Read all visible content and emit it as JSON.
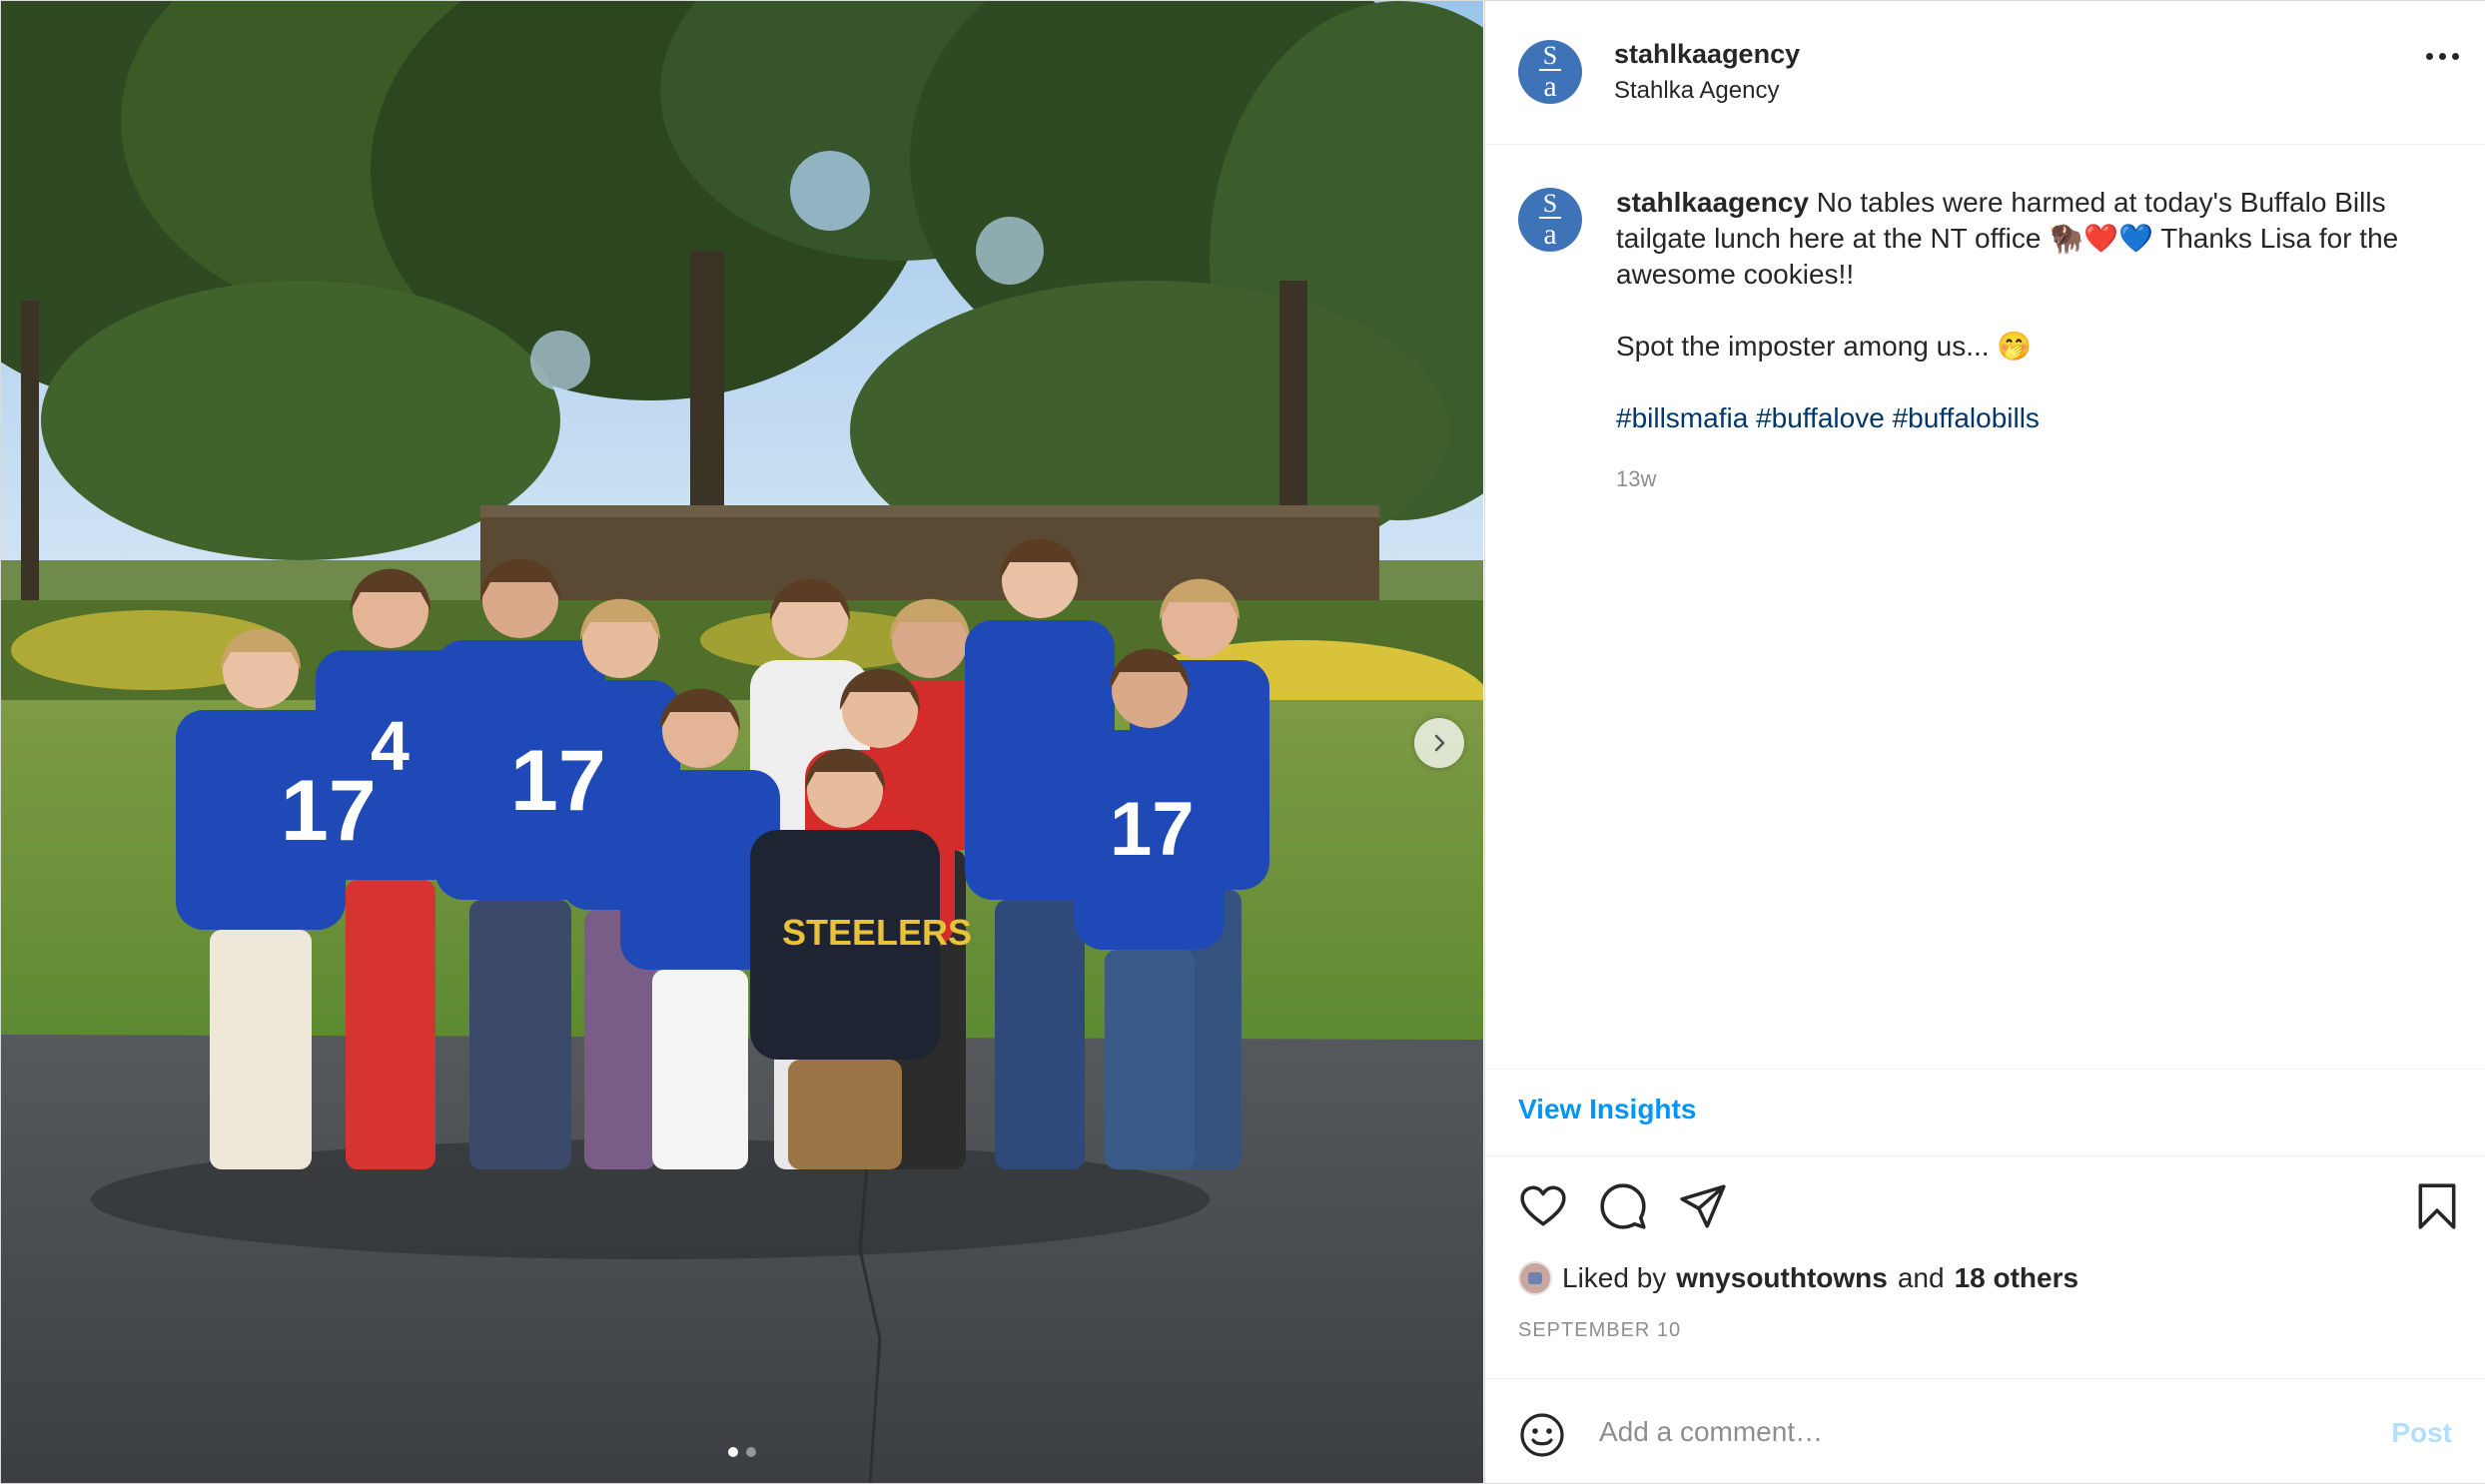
{
  "colors": {
    "accent": "#0095f6",
    "avatar_bg": "#3f73b8",
    "hashtag": "#00376b",
    "muted": "#8e8e8e",
    "post_disabled": "#b2dffc",
    "bills_blue": "#1f49b6",
    "bills_red": "#d42b2b"
  },
  "photo": {
    "description_icon": "group-photo",
    "jersey_numbers": [
      "17",
      "4",
      "17",
      "17"
    ],
    "shirt_text": "STEELERS",
    "carousel": {
      "total": 2,
      "current": 1
    },
    "next_icon": "chevron-right-icon"
  },
  "header": {
    "avatar_letters": {
      "top": "S",
      "bottom": "a"
    },
    "username": "stahlkaagency",
    "subname": "Stahlka Agency",
    "more_icon": "more-horizontal-icon"
  },
  "caption": {
    "username": "stahlkaagency",
    "text": " No tables were harmed at today's Buffalo Bills tailgate lunch here at the NT office 🦬❤️💙 Thanks Lisa for the awesome cookies!!",
    "line2": "Spot the imposter among us... 🤭",
    "hashtags": [
      "#billsmafia",
      "#buffalove",
      "#buffalobills"
    ],
    "time": "13w"
  },
  "insights": {
    "label": "View Insights"
  },
  "actions": {
    "like_icon": "heart-icon",
    "comment_icon": "comment-icon",
    "share_icon": "share-icon",
    "save_icon": "bookmark-icon"
  },
  "likes": {
    "prefix": "Liked by",
    "user": "wnysouthtowns",
    "middle": "and",
    "others": "18 others"
  },
  "date": "SEPTEMBER 10",
  "comment": {
    "emoji_icon": "smiley-icon",
    "placeholder": "Add a comment…",
    "post_label": "Post"
  }
}
